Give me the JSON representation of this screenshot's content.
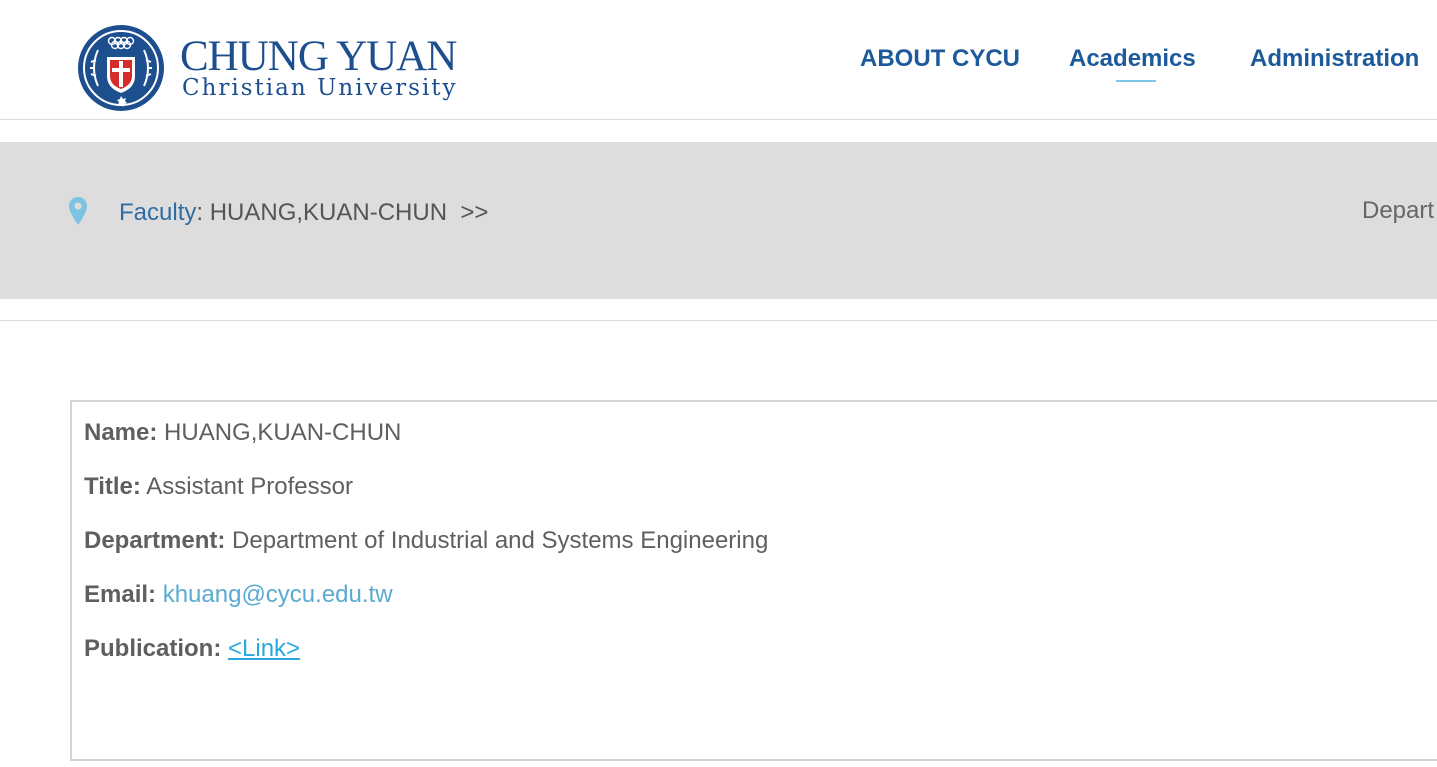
{
  "header": {
    "logo": {
      "name": "CHUNG YUAN",
      "subtitle": "Christian University"
    },
    "nav": [
      {
        "label": "ABOUT CYCU"
      },
      {
        "label": "Academics",
        "active": true
      },
      {
        "label": "Administration"
      }
    ]
  },
  "breadcrumb": {
    "icon": "map-pin-icon",
    "link_label": "Faculty",
    "separator": ":",
    "current": " HUANG,KUAN-CHUN",
    "arrow": ">>",
    "right_text": "Depart"
  },
  "profile": {
    "rows": [
      {
        "label": "Name:",
        "value": "HUANG,KUAN-CHUN"
      },
      {
        "label": "Title:",
        "value": "Assistant Professor"
      },
      {
        "label": "Department:",
        "value": "Department of Industrial and Systems Engineering"
      },
      {
        "label": "Email:",
        "value": "khuang@cycu.edu.tw"
      },
      {
        "label": "Publication:",
        "value": "<Link>"
      }
    ]
  },
  "colors": {
    "brand_blue": "#1d4f8f",
    "nav_blue": "#1d5a9c",
    "accent_light_blue": "#7ec3e3",
    "link_blue": "#2aa8dc",
    "seal_red": "#d62b2b",
    "breadcrumb_bg": "#dddddd"
  }
}
